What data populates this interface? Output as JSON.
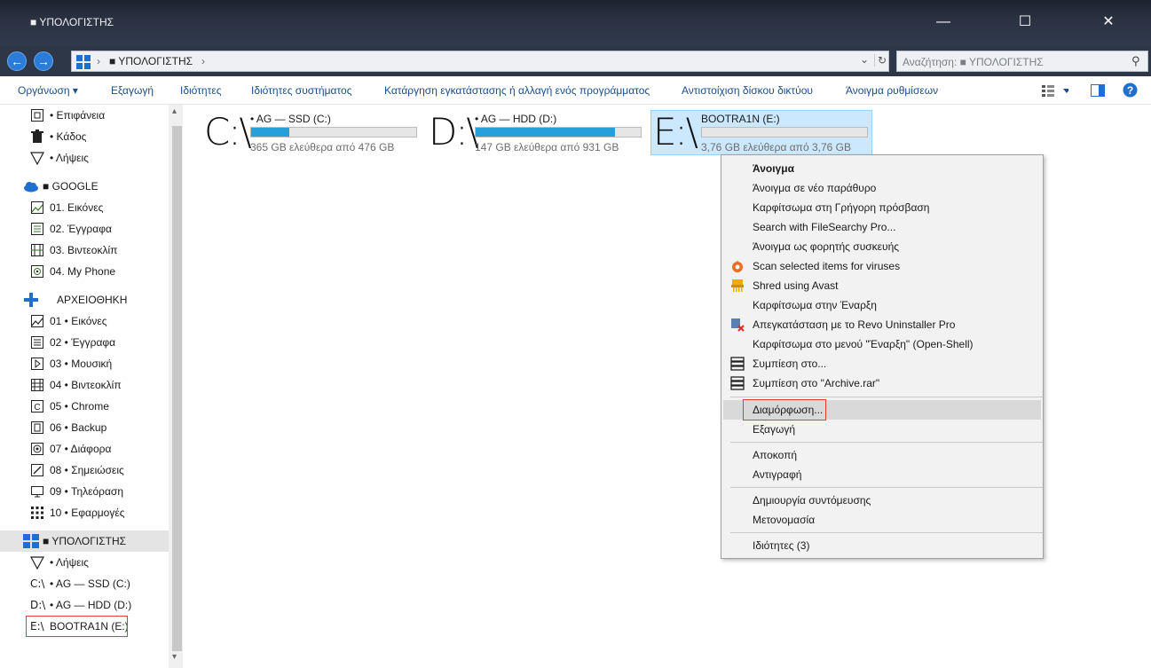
{
  "window": {
    "title": "■ ΥΠΟΛΟΓΙΣΤΗΣ",
    "minimize": "—",
    "maximize": "☐",
    "close": "✕"
  },
  "address": {
    "back_icon": "←",
    "forward_icon": "→",
    "sep1": "›",
    "location": "■ ΥΠΟΛΟΓΙΣΤΗΣ",
    "sep2": "›",
    "dropdown_icon": "⌄",
    "refresh_icon": "↻",
    "search_placeholder": "Αναζήτηση: ■ ΥΠΟΛΟΓΙΣΤΗΣ",
    "search_icon": "⚲"
  },
  "commands": [
    "Οργάνωση ▾",
    "Εξαγωγή",
    "Ιδιότητες",
    "Ιδιότητες συστήματος",
    "Κατάργηση εγκατάστασης ή αλλαγή ενός προγράμματος",
    "Αντιστοίχιση δίσκου δικτύου",
    "Άνοιγμα ρυθμίσεων"
  ],
  "sidebar": {
    "items": [
      {
        "label": "• Επιφάνεια",
        "icon": "desktop-icon"
      },
      {
        "label": "• Κάδος",
        "icon": "trash-icon"
      },
      {
        "label": "• Λήψεις",
        "icon": "download-icon"
      },
      {
        "label": "■ GOOGLE",
        "icon": "cloud-icon"
      },
      {
        "label": "01. Εικόνες",
        "icon": "image-icon"
      },
      {
        "label": "02. Έγγραφα",
        "icon": "document-icon"
      },
      {
        "label": "03. Βιντεοκλίπ",
        "icon": "video-icon"
      },
      {
        "label": "04. My Phone",
        "icon": "phone-icon"
      },
      {
        "label": "ΑΡΧΕΙΟΘΗΚΗ",
        "icon": "plus-icon"
      },
      {
        "label": "01 • Εικόνες",
        "icon": "image-icon"
      },
      {
        "label": "02 • Έγγραφα",
        "icon": "document-icon"
      },
      {
        "label": "03 • Μουσική",
        "icon": "music-icon"
      },
      {
        "label": "04 • Βιντεοκλίπ",
        "icon": "video-icon"
      },
      {
        "label": "05 • Chrome",
        "icon": "chrome-icon"
      },
      {
        "label": "06 • Backup",
        "icon": "backup-icon"
      },
      {
        "label": "07 • Διάφορα",
        "icon": "misc-icon"
      },
      {
        "label": "08 • Σημειώσεις",
        "icon": "notes-icon"
      },
      {
        "label": "09 • Τηλεόραση",
        "icon": "tv-icon"
      },
      {
        "label": "10 • Εφαρμογές",
        "icon": "apps-icon"
      },
      {
        "label": "■ ΥΠΟΛΟΓΙΣΤΗΣ",
        "icon": "computer-icon"
      },
      {
        "label": "• Λήψεις",
        "icon": "download-icon"
      },
      {
        "label": "• AG — SSD (C:)",
        "icon": "drive-icon",
        "prefix": "C:\\"
      },
      {
        "label": "• AG — HDD (D:)",
        "icon": "drive-icon",
        "prefix": "D:\\"
      },
      {
        "label": "BOOTRA1N (E:)",
        "icon": "drive-icon",
        "prefix": "E:\\"
      }
    ]
  },
  "drives": [
    {
      "letter": "C:\\",
      "name": "• AG — SSD (C:)",
      "free": "365 GB ελεύθερα από 476 GB",
      "used_fraction": 0.233
    },
    {
      "letter": "D:\\",
      "name": "• AG — HDD (D:)",
      "free": "147 GB ελεύθερα από 931 GB",
      "used_fraction": 0.842
    },
    {
      "letter": "E:\\",
      "name": "BOOTRA1N (E:)",
      "free": "3,76 GB ελεύθερα από 3,76 GB",
      "used_fraction": 0.0
    }
  ],
  "context_menu": {
    "items": [
      "Άνοιγμα",
      "Άνοιγμα σε νέο παράθυρο",
      "Καρφίτσωμα στη Γρήγορη πρόσβαση",
      "Search with FileSearchy Pro...",
      "Άνοιγμα ως φορητής συσκευής",
      "Scan selected items for viruses",
      "Shred using Avast",
      "Καρφίτσωμα στην Έναρξη",
      "Απεγκατάσταση με το Revo Uninstaller Pro",
      "Καρφίτσωμα στο μενού \"Έναρξη\" (Open-Shell)",
      "Συμπίεση στο...",
      "Συμπίεση στο \"Archive.rar\"",
      "Διαμόρφωση...",
      "Εξαγωγή",
      "Αποκοπή",
      "Αντιγραφή",
      "Δημιουργία συντόμευσης",
      "Μετονομασία",
      "Ιδιότητες (3)"
    ]
  },
  "colors": {
    "accent": "#26a0da",
    "highlight": "#e23b3b",
    "selection": "#cce8ff"
  }
}
